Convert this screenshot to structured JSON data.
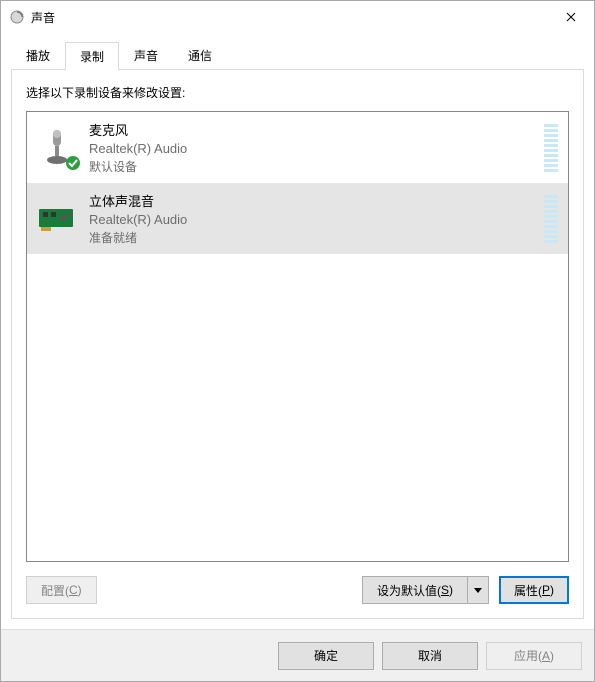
{
  "window": {
    "title": "声音"
  },
  "tabs": {
    "playback": "播放",
    "recording": "录制",
    "sound": "声音",
    "comm": "通信",
    "active": "recording"
  },
  "instruction": "选择以下录制设备来修改设置:",
  "devices": [
    {
      "name": "麦克风",
      "driver": "Realtek(R) Audio",
      "status": "默认设备",
      "default": true,
      "icon": "microphone"
    },
    {
      "name": "立体声混音",
      "driver": "Realtek(R) Audio",
      "status": "准备就绪",
      "selected": true,
      "icon": "soundcard"
    }
  ],
  "buttons": {
    "configure": "配置(",
    "configure_k": "C",
    "configure_e": ")",
    "setdefault": "设为默认值(",
    "setdefault_k": "S",
    "setdefault_e": ")",
    "properties": "属性(",
    "properties_k": "P",
    "properties_e": ")"
  },
  "footer": {
    "ok": "确定",
    "cancel": "取消",
    "apply": "应用(",
    "apply_k": "A",
    "apply_e": ")"
  }
}
